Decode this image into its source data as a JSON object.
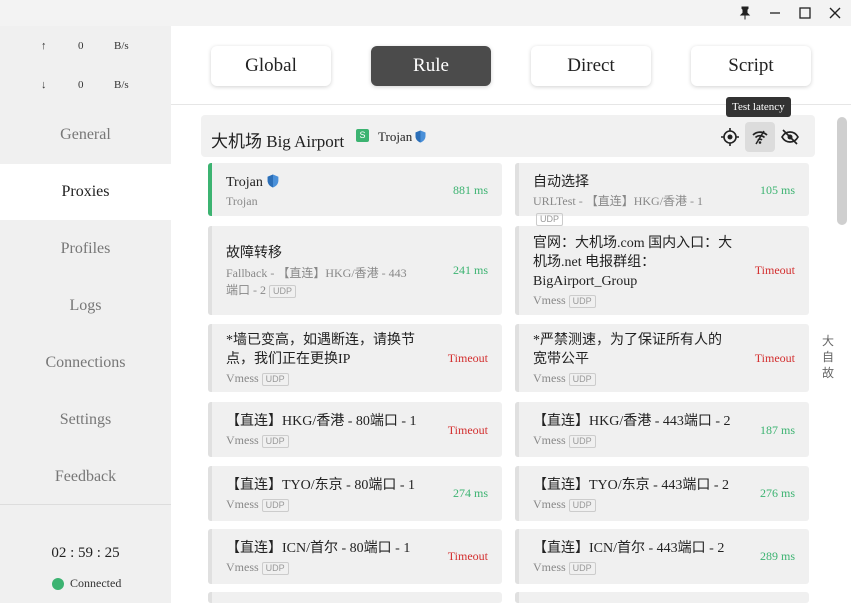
{
  "titlebar": {
    "pin_icon": "pin-icon",
    "minimize_icon": "minimize-icon",
    "maximize_icon": "maximize-icon",
    "close_icon": "close-icon"
  },
  "traffic": {
    "upload": {
      "arrow": "↑",
      "value": "0",
      "unit": "B/s"
    },
    "download": {
      "arrow": "↓",
      "value": "0",
      "unit": "B/s"
    }
  },
  "nav": [
    "General",
    "Proxies",
    "Profiles",
    "Logs",
    "Connections",
    "Settings",
    "Feedback"
  ],
  "nav_active": "Proxies",
  "footer": {
    "time": "02 : 59 : 25",
    "status": "Connected"
  },
  "modes": [
    "Global",
    "Rule",
    "Direct",
    "Script"
  ],
  "mode_active": "Rule",
  "tooltip": "Test latency",
  "group": {
    "name": "大机场 Big Airport",
    "badge": "S",
    "type": "Trojan"
  },
  "proxies": [
    {
      "name": "Trojan",
      "shield": true,
      "sub": "Trojan",
      "udp": false,
      "latency": "881 ms",
      "ok": true,
      "selected": true
    },
    {
      "name": "自动选择",
      "sub": "URLTest - 【直连】HKG/香港 - 1",
      "udp": true,
      "latency": "105 ms",
      "ok": true
    },
    {
      "name": "故障转移",
      "sub": "Fallback - 【直连】HKG/香港 - 443端口 - 2",
      "udp": true,
      "latency": "241 ms",
      "ok": true
    },
    {
      "name": "官网：大机场.com 国内入口：大机场.net 电报群组：BigAirport_Group",
      "sub": "Vmess",
      "udp": true,
      "latency": "Timeout",
      "ok": false
    },
    {
      "name": "*墙已变高，如遇断连，请换节点，我们正在更换IP",
      "sub": "Vmess",
      "udp": true,
      "latency": "Timeout",
      "ok": false
    },
    {
      "name": "*严禁测速，为了保证所有人的宽带公平",
      "sub": "Vmess",
      "udp": true,
      "latency": "Timeout",
      "ok": false
    },
    {
      "name": "【直连】HKG/香港 - 80端口 - 1",
      "sub": "Vmess",
      "udp": true,
      "latency": "Timeout",
      "ok": false
    },
    {
      "name": "【直连】HKG/香港 - 443端口 - 2",
      "sub": "Vmess",
      "udp": true,
      "latency": "187 ms",
      "ok": true
    },
    {
      "name": "【直连】TYO/东京 - 80端口 - 1",
      "sub": "Vmess",
      "udp": true,
      "latency": "274 ms",
      "ok": true
    },
    {
      "name": "【直连】TYO/东京 - 443端口 - 2",
      "sub": "Vmess",
      "udp": true,
      "latency": "276 ms",
      "ok": true
    },
    {
      "name": "【直连】ICN/首尔 - 80端口 - 1",
      "sub": "Vmess",
      "udp": true,
      "latency": "Timeout",
      "ok": false
    },
    {
      "name": "【直连】ICN/首尔 - 443端口 - 2",
      "sub": "Vmess",
      "udp": true,
      "latency": "289 ms",
      "ok": true
    }
  ],
  "udp_label": "UDP",
  "side_note": "大自故",
  "colors": {
    "accent": "#3cb371",
    "timeout": "#d32f2f",
    "active_mode": "#4b4b4b"
  }
}
